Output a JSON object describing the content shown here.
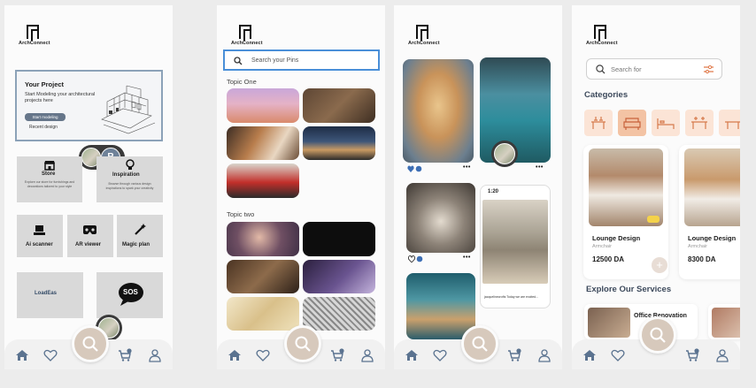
{
  "brand": {
    "name": "ArchConnect"
  },
  "colors": {
    "accent_blue": "#4a8fd8",
    "nav_icon": "#5b7390",
    "fab": "#d7c9bc",
    "peach": "#fbe4d6",
    "peach_active": "#f3c3a4",
    "heading": "#3d4a5c"
  },
  "screen1": {
    "project": {
      "title": "Your Project",
      "description": "Start Modeling your architectural projects here",
      "button": "Start modeling",
      "recent": "Recent design"
    },
    "avatar_letter": "R",
    "tiles": {
      "store": {
        "label": "Store",
        "desc": "Explore our store for furnishings and decorations tailored to your style"
      },
      "inspiration": {
        "label": "Inspiration",
        "desc": "Browse through various design inspirations to spark your creativity"
      },
      "ai_scanner": "Ai scanner",
      "ar_viewer": "AR viewer",
      "magic_plan": "Magic plan",
      "loadeas": "LoadEas",
      "sos": "SOS"
    }
  },
  "screen2": {
    "search_placeholder": "Search your Pins",
    "topic_one": "Topic One",
    "topic_two": "Topic two"
  },
  "screen3": {
    "time": "1:20",
    "post_caption": "jacquelinecrofts Today we are excited...",
    "more": "•••"
  },
  "screen4": {
    "search_placeholder": "Search for",
    "categories_title": "Categories",
    "products": [
      {
        "name": "Lounge Design",
        "category": "Armchair",
        "price": "12500 DA"
      },
      {
        "name": "Lounge Design",
        "category": "Armchair",
        "price": "8300 DA"
      }
    ],
    "add_symbol": "+",
    "services_title": "Explore Our Services",
    "service": "Office Renovation"
  },
  "icons": [
    "home-icon",
    "heart-icon",
    "search-icon",
    "cart-icon",
    "user-icon",
    "store-icon",
    "bulb-icon",
    "scanner-icon",
    "vr-icon",
    "magic-wand-icon",
    "filter-icon",
    "comment-icon"
  ]
}
